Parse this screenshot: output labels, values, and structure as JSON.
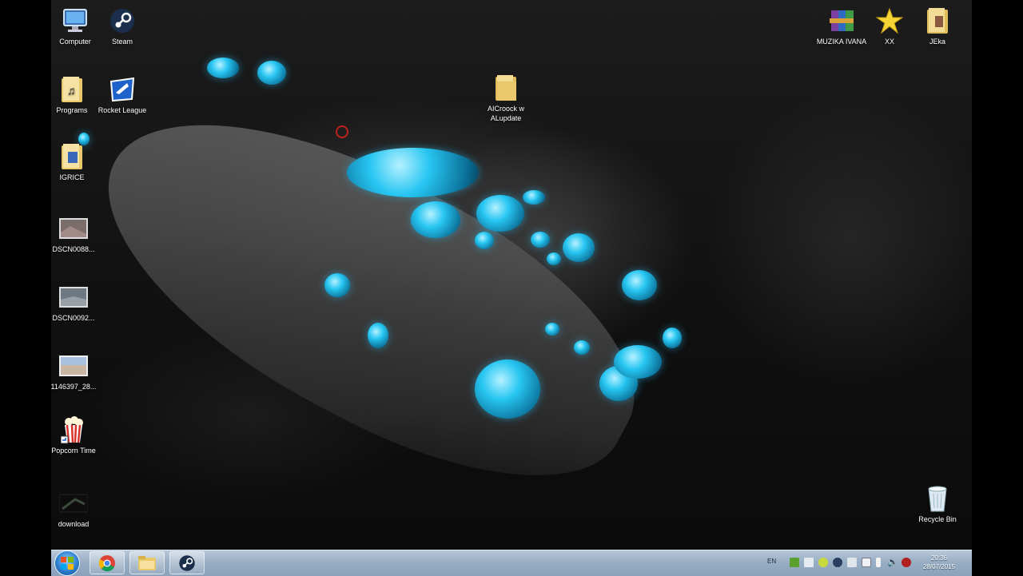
{
  "desktop": {
    "left_icons": [
      {
        "label": "Computer",
        "icon": "computer-icon"
      },
      {
        "label": "Steam",
        "icon": "steam-icon"
      },
      {
        "label": "Programs",
        "icon": "folder-icon"
      },
      {
        "label": "Rocket League",
        "icon": "rocket-league-icon"
      },
      {
        "label": "IGRICE",
        "icon": "folder-icon"
      },
      {
        "label": "DSCN0088...",
        "icon": "photo-icon"
      },
      {
        "label": "DSCN0092...",
        "icon": "photo-icon"
      },
      {
        "label": "1146397_28...",
        "icon": "photo-icon"
      },
      {
        "label": "Popcorn Time",
        "icon": "popcorn-time-icon"
      },
      {
        "label": "download",
        "icon": "image-file-icon"
      }
    ],
    "center_icon": {
      "label": "AICroock w ALupdate",
      "icon": "folder-icon"
    },
    "right_icons": [
      {
        "label": "MUZIKA IVANA",
        "icon": "winrar-archive-icon"
      },
      {
        "label": "XX",
        "icon": "star-icon"
      },
      {
        "label": "JEka",
        "icon": "folder-icon"
      }
    ],
    "recycle_bin": {
      "label": "Recycle Bin",
      "icon": "recycle-bin-icon"
    }
  },
  "taskbar": {
    "pinned": [
      {
        "name": "chrome",
        "icon": "chrome-icon"
      },
      {
        "name": "explorer",
        "icon": "folder-icon"
      },
      {
        "name": "steam",
        "icon": "steam-icon"
      }
    ],
    "language": "EN",
    "clock": {
      "time": "20:36",
      "date": "28/07/2015"
    }
  },
  "colors": {
    "accent": "#27c6f2",
    "taskbar": "#98aec4"
  }
}
